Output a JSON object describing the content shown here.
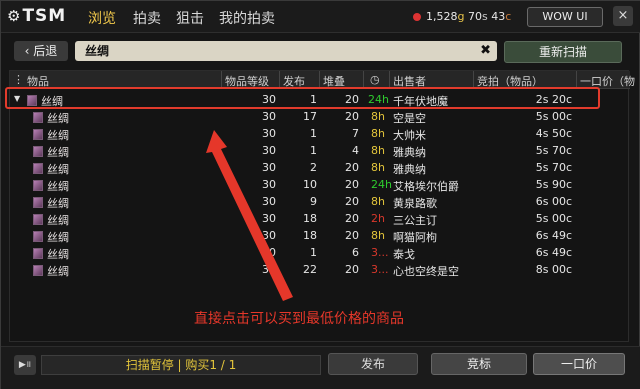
{
  "header": {
    "logo": "TSM",
    "tabs": [
      {
        "label": "浏览",
        "active": true
      },
      {
        "label": "拍卖",
        "active": false
      },
      {
        "label": "狙击",
        "active": false
      },
      {
        "label": "我的拍卖",
        "active": false
      }
    ],
    "gold": "1,528",
    "gold_unit": "g",
    "silver": "70",
    "silver_unit": "s",
    "copper": "43",
    "copper_unit": "c",
    "wowui_label": "WOW UI",
    "close_label": "×"
  },
  "search": {
    "back_label": "后退",
    "query": "丝绸",
    "rescan_label": "重新扫描"
  },
  "table": {
    "columns": [
      "物品",
      "物品等级",
      "发布",
      "堆叠",
      "",
      "出售者",
      "竞拍（物品）",
      "一口价（物"
    ],
    "group": {
      "name": "丝绸",
      "ilvl": "30",
      "posted": "1",
      "stack": "20",
      "time": "24h",
      "seller": "千年伏地魔",
      "bid": "2s 20c"
    },
    "rows": [
      {
        "name": "丝绸",
        "ilvl": "30",
        "posted": "17",
        "stack": "20",
        "time": "8h",
        "time_color": "yellow",
        "seller": "空是空",
        "bid": "5s 00c"
      },
      {
        "name": "丝绸",
        "ilvl": "30",
        "posted": "1",
        "stack": "7",
        "time": "8h",
        "time_color": "yellow",
        "seller": "大帅米",
        "bid": "4s 50c"
      },
      {
        "name": "丝绸",
        "ilvl": "30",
        "posted": "1",
        "stack": "4",
        "time": "8h",
        "time_color": "yellow",
        "seller": "雅典纳",
        "bid": "5s 70c"
      },
      {
        "name": "丝绸",
        "ilvl": "30",
        "posted": "2",
        "stack": "20",
        "time": "8h",
        "time_color": "yellow",
        "seller": "雅典纳",
        "bid": "5s 70c"
      },
      {
        "name": "丝绸",
        "ilvl": "30",
        "posted": "10",
        "stack": "20",
        "time": "24h",
        "time_color": "green",
        "seller": "艾格埃尔伯爵",
        "bid": "5s 90c"
      },
      {
        "name": "丝绸",
        "ilvl": "30",
        "posted": "9",
        "stack": "20",
        "time": "8h",
        "time_color": "yellow",
        "seller": "黄泉路歌",
        "bid": "6s 00c"
      },
      {
        "name": "丝绸",
        "ilvl": "30",
        "posted": "18",
        "stack": "20",
        "time": "2h",
        "time_color": "red",
        "seller": "三公主订",
        "bid": "5s 00c"
      },
      {
        "name": "丝绸",
        "ilvl": "30",
        "posted": "18",
        "stack": "20",
        "time": "8h",
        "time_color": "yellow",
        "seller": "啊猫阿枸",
        "bid": "6s 49c"
      },
      {
        "name": "丝绸",
        "ilvl": "30",
        "posted": "1",
        "stack": "6",
        "time": "3...",
        "time_color": "red",
        "seller": "泰戈",
        "bid": "6s 49c"
      },
      {
        "name": "丝绸",
        "ilvl": "30",
        "posted": "22",
        "stack": "20",
        "time": "3...",
        "time_color": "red",
        "seller": "心也空终是空",
        "bid": "8s 00c"
      }
    ]
  },
  "annotation": "直接点击可以买到最低价格的商品",
  "footer": {
    "status": "扫描暂停 | 购买1 / 1",
    "post_label": "发布",
    "bid_label": "竞标",
    "buyout_label": "一口价"
  },
  "colors": {
    "accent": "#f1c84b",
    "highlight": "#e23b2c",
    "green": "#2ecc2e",
    "yellow": "#e3c53b",
    "red": "#d9382c"
  }
}
